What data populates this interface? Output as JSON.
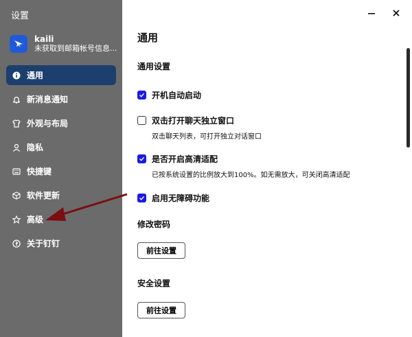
{
  "sidebar": {
    "title": "设置",
    "user": {
      "name": "kaili",
      "subtitle": "未获取到邮箱帐号信息..."
    },
    "items": [
      {
        "label": "通用",
        "icon": "info-icon",
        "active": true
      },
      {
        "label": "新消息通知",
        "icon": "bell-icon",
        "active": false
      },
      {
        "label": "外观与布局",
        "icon": "shirt-icon",
        "active": false
      },
      {
        "label": "隐私",
        "icon": "user-icon",
        "active": false
      },
      {
        "label": "快捷键",
        "icon": "keyboard-icon",
        "active": false
      },
      {
        "label": "软件更新",
        "icon": "cube-icon",
        "active": false
      },
      {
        "label": "高级",
        "icon": "star-icon",
        "active": false
      },
      {
        "label": "关于钉钉",
        "icon": "ding-icon",
        "active": false
      }
    ]
  },
  "main": {
    "title": "通用",
    "general_section": "通用设置",
    "options": [
      {
        "label": "开机自动启动",
        "checked": true
      },
      {
        "label": "双击打开聊天独立窗口",
        "checked": false,
        "desc": "双击聊天列表，可打开独立对话窗口"
      },
      {
        "label": "是否开启高清适配",
        "checked": true,
        "desc": "已按系统设置的比例放大到100%。如无需放大，可关闭高清适配"
      },
      {
        "label": "启用无障碍功能",
        "checked": true
      }
    ],
    "password_section": "修改密码",
    "password_button": "前往设置",
    "security_section": "安全设置",
    "security_button": "前往设置"
  },
  "colors": {
    "accent": "#1a1ae6",
    "active_nav": "#1c3f6d",
    "annotation_arrow": "#7a0f12"
  }
}
